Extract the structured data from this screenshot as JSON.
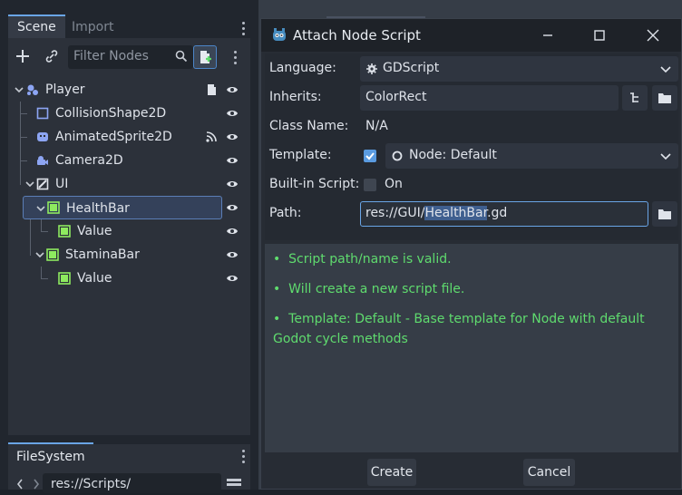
{
  "scene_dock": {
    "tabs": [
      {
        "label": "Scene",
        "active": true
      },
      {
        "label": "Import",
        "active": false
      }
    ],
    "filter_placeholder": "Filter Nodes",
    "nodes": [
      {
        "label": "Player",
        "icon": "node2d-icon",
        "level": 0,
        "extra": "script-icon"
      },
      {
        "label": "CollisionShape2D",
        "icon": "collision-shape-icon",
        "level": 1
      },
      {
        "label": "AnimatedSprite2D",
        "icon": "animated-sprite-icon",
        "level": 1,
        "extra": "signal-icon"
      },
      {
        "label": "Camera2D",
        "icon": "camera-icon",
        "level": 1
      },
      {
        "label": "UI",
        "icon": "control-icon",
        "level": 1
      },
      {
        "label": "HealthBar",
        "icon": "colorrect-icon",
        "level": 2,
        "selected": true
      },
      {
        "label": "Value",
        "icon": "colorrect-icon",
        "level": 3
      },
      {
        "label": "StaminaBar",
        "icon": "colorrect-icon",
        "level": 2
      },
      {
        "label": "Value",
        "icon": "colorrect-icon",
        "level": 3
      }
    ]
  },
  "filesystem": {
    "tab_label": "FileSystem",
    "path": "res://Scripts/"
  },
  "dialog": {
    "title": "Attach Node Script",
    "fields": {
      "language_label": "Language:",
      "language_value": "GDScript",
      "inherits_label": "Inherits:",
      "inherits_value": "ColorRect",
      "class_name_label": "Class Name:",
      "class_name_value": "N/A",
      "template_label": "Template:",
      "template_value": "Node: Default",
      "builtin_label": "Built-in Script:",
      "builtin_value": "On",
      "path_label": "Path:",
      "path_prefix": "res://GUI/",
      "path_highlight": "HealthBar",
      "path_suffix": ".gd"
    },
    "messages": [
      "Script path/name is valid.",
      "Will create a new script file.",
      "Template: Default - Base template for Node with default Godot cycle methods"
    ],
    "bullet": "•",
    "create_label": "Create",
    "cancel_label": "Cancel"
  },
  "colors": {
    "accent": "#6aa5e6",
    "valid_text": "#5fdb6e",
    "colorrect_icon": "#8eea5f"
  }
}
